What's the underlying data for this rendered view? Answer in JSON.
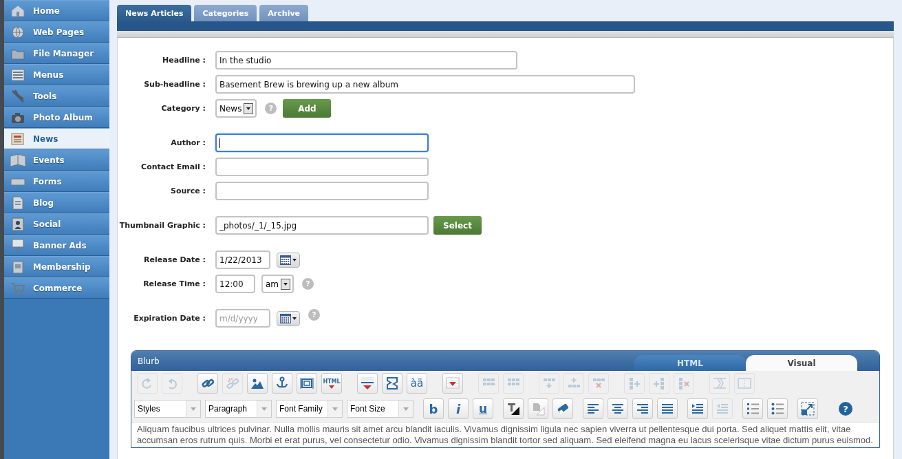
{
  "sidebar": {
    "items": [
      {
        "label": "Home",
        "selected": false
      },
      {
        "label": "Web Pages",
        "selected": false
      },
      {
        "label": "File Manager",
        "selected": false
      },
      {
        "label": "Menus",
        "selected": false
      },
      {
        "label": "Tools",
        "selected": false
      },
      {
        "label": "Photo Album",
        "selected": false
      },
      {
        "label": "News",
        "selected": true
      },
      {
        "label": "Events",
        "selected": false
      },
      {
        "label": "Forms",
        "selected": false
      },
      {
        "label": "Blog",
        "selected": false
      },
      {
        "label": "Social",
        "selected": false
      },
      {
        "label": "Banner Ads",
        "selected": false
      },
      {
        "label": "Membership",
        "selected": false
      },
      {
        "label": "Commerce",
        "selected": false
      }
    ]
  },
  "tabs": [
    {
      "label": "News Articles",
      "selected": true
    },
    {
      "label": "Categories",
      "selected": false
    },
    {
      "label": "Archive",
      "selected": false
    }
  ],
  "form": {
    "headline": {
      "label": "Headline :",
      "value": "In the studio"
    },
    "subheadline": {
      "label": "Sub-headline :",
      "value": "Basement Brew  is brewing up a new album"
    },
    "category": {
      "label": "Category :",
      "value": "News",
      "help": "?",
      "button": "Add"
    },
    "author": {
      "label": "Author :",
      "focused": true
    },
    "contact_email": {
      "label": "Contact Email :",
      "focused": false
    },
    "source": {
      "label": "Source :",
      "focused": false
    },
    "thumbnail": {
      "label": "Thumbnail Graphic :",
      "value": "_photos/_1/_15.jpg",
      "button": "Select"
    },
    "release_date": {
      "label": "Release Date :",
      "value": "1/22/2013"
    },
    "release_time": {
      "label": "Release Time :",
      "value": "12:00",
      "period": "am",
      "help": "?"
    },
    "expiration_date": {
      "label": "Expiration Date :",
      "placeholder": "m/d/yyyy",
      "help": "?"
    }
  },
  "editor": {
    "title": "Blurb",
    "tabs": [
      {
        "label": "HTML",
        "selected": false
      },
      {
        "label": "Visual",
        "selected": true
      }
    ],
    "toolbar": [
      {
        "groups": [
          [
            {
              "kind": "icon",
              "disabled": true
            },
            {
              "kind": "icon",
              "disabled": true
            }
          ],
          [
            {
              "kind": "icon",
              "disabled": false
            },
            {
              "kind": "icon",
              "disabled": true
            },
            {
              "kind": "icon",
              "disabled": false
            },
            {
              "kind": "icon",
              "disabled": false
            },
            {
              "kind": "icon",
              "disabled": false
            },
            {
              "kind": "text",
              "label": "HTML",
              "disabled": false
            }
          ],
          [
            {
              "kind": "icon",
              "disabled": false
            },
            {
              "kind": "icon",
              "disabled": false
            },
            {
              "kind": "text",
              "label": "àä",
              "disabled": false
            }
          ],
          [
            {
              "kind": "icon",
              "disabled": false
            }
          ],
          [
            {
              "kind": "icon",
              "disabled": true
            },
            {
              "kind": "icon",
              "disabled": true
            }
          ],
          [
            {
              "kind": "icon",
              "disabled": true
            },
            {
              "kind": "icon",
              "disabled": true
            },
            {
              "kind": "icon",
              "disabled": true
            }
          ],
          [
            {
              "kind": "icon",
              "disabled": true
            },
            {
              "kind": "icon",
              "disabled": true
            },
            {
              "kind": "icon",
              "disabled": true
            }
          ],
          [
            {
              "kind": "icon",
              "disabled": true
            },
            {
              "kind": "icon",
              "disabled": true
            }
          ]
        ]
      },
      {
        "groups": [
          [
            {
              "kind": "select",
              "label": "Styles"
            },
            {
              "kind": "select",
              "label": "Paragraph"
            },
            {
              "kind": "select",
              "label": "Font Family"
            },
            {
              "kind": "select",
              "label": "Font Size"
            }
          ],
          [
            {
              "kind": "text",
              "label": "b",
              "disabled": false
            },
            {
              "kind": "text",
              "label": "i",
              "disabled": false
            },
            {
              "kind": "text",
              "label": "u",
              "disabled": false
            }
          ],
          [
            {
              "kind": "icon",
              "disabled": false
            },
            {
              "kind": "icon",
              "disabled": false
            },
            {
              "kind": "icon",
              "disabled": false
            }
          ],
          [
            {
              "kind": "icon",
              "disabled": false
            },
            {
              "kind": "icon",
              "disabled": false
            },
            {
              "kind": "icon",
              "disabled": false
            },
            {
              "kind": "icon",
              "disabled": false
            }
          ],
          [
            {
              "kind": "icon",
              "disabled": false
            },
            {
              "kind": "icon",
              "disabled": true
            }
          ],
          [
            {
              "kind": "icon",
              "disabled": false
            },
            {
              "kind": "icon",
              "disabled": false
            }
          ],
          [
            {
              "kind": "icon",
              "disabled": false
            }
          ],
          [
            {
              "kind": "help",
              "label": "?"
            }
          ]
        ]
      }
    ],
    "content": "Aliquam faucibus ultrices pulvinar. Nulla mollis mauris sit amet arcu blandit iaculis. Vivamus dignissim ligula nec sapien viverra ut pellentesque dui porta. Sed aliquet mattis elit, vitae accumsan eros rutrum quis. Morbi et erat purus, vel consectetur odio. Vivamus dignissim blandit tortor sed aliquam. Sed eleifend magna eu lacus scelerisque vitae dictum purus euismod."
  }
}
